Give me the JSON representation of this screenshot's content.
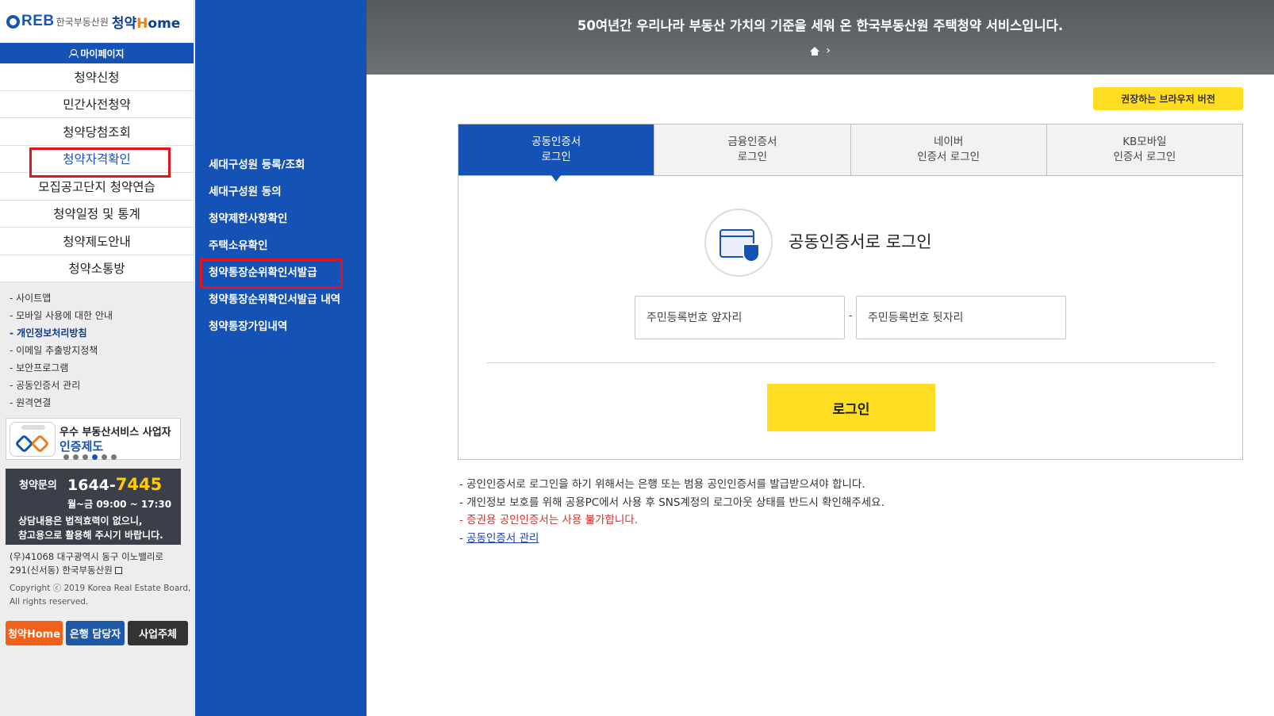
{
  "logo": {
    "reb": "REB",
    "org": "한국부동산원",
    "service_main": "청약",
    "service_h": "H",
    "service_rest": "ome"
  },
  "mypage": {
    "label": "마이페이지"
  },
  "main_nav": [
    {
      "label": "청약신청"
    },
    {
      "label": "민간사전청약"
    },
    {
      "label": "청약당첨조회"
    },
    {
      "label": "청약자격확인"
    },
    {
      "label": "모집공고단지 청약연습"
    },
    {
      "label": "청약일정 및 통계"
    },
    {
      "label": "청약제도안내"
    },
    {
      "label": "청약소통방"
    }
  ],
  "footer_links": [
    "- 사이트맵",
    "- 모바일 사용에 대한 안내",
    "- 개인정보처리방침",
    "- 이메일 추출방지정책",
    "- 보안프로그램",
    "- 공동인증서 관리",
    "- 원격연결"
  ],
  "cert_badge": {
    "line1": "우수 부동산서비스 사업자",
    "line2": "인증제도"
  },
  "callcenter": {
    "label": "청약문의",
    "number_prefix": "1644-",
    "number_suffix": "7445",
    "hours": "월~금 09:00 ~ 17:30",
    "note_line1": "상담내용은 법적효력이 없으니,",
    "note_line2": "참고용으로 활용해 주시기 바랍니다."
  },
  "address": {
    "line1": "(우)41068 대구광역시 동구 이노밸리로",
    "line2": "291(신서동) 한국부동산원"
  },
  "copyright": {
    "line1": "Copyright ⓒ 2019 Korea Real Estate Board,",
    "line2": "All rights reserved."
  },
  "user_buttons": [
    "청약Home",
    "은행 담당자",
    "사업주체"
  ],
  "sub_menu": [
    {
      "label": "세대구성원 등록/조회"
    },
    {
      "label": "세대구성원 동의"
    },
    {
      "label": "청약제한사항확인"
    },
    {
      "label": "주택소유확인"
    },
    {
      "label": "청약통장순위확인서발급"
    },
    {
      "label": "청약통장순위확인서발급 내역"
    },
    {
      "label": "청약통장가입내역"
    }
  ],
  "hero": {
    "tagline": "50여년간 우리나라 부동산 가치의 기준을 세워 온 한국부동산원 주택청약 서비스입니다."
  },
  "browser_button": "권장하는 브라우저 버전",
  "login_tabs": [
    {
      "line1": "공동인증서",
      "line2": "로그인"
    },
    {
      "line1": "금융인증서",
      "line2": "로그인"
    },
    {
      "line1": "네이버",
      "line2": "인증서 로그인"
    },
    {
      "line1": "KB모바일",
      "line2": "인증서 로그인"
    }
  ],
  "login": {
    "title": "공동인증서로 로그인",
    "rrn_front_placeholder": "주민등록번호 앞자리",
    "rrn_back_placeholder": "주민등록번호 뒷자리",
    "separator": "-",
    "button": "로그인"
  },
  "notices": {
    "n1": "- 공인인증서로 로그인을 하기 위해서는 은행 또는 범용 공인인증서를 발급받으셔야 합니다.",
    "n2": "- 개인정보 보호를 위해 공용PC에서 사용 후 SNS계정의 로그아웃 상태를 반드시 확인해주세요.",
    "n3": "- 증권용 공인인증서는 사용 불가합니다.",
    "n4_prefix": "- ",
    "n4_link": "공동인증서 관리"
  },
  "colors": {
    "brand_blue": "#1552b5",
    "accent_yellow": "#ffdd22",
    "highlight_red": "#e1141c",
    "warning_red": "#d0312d"
  }
}
